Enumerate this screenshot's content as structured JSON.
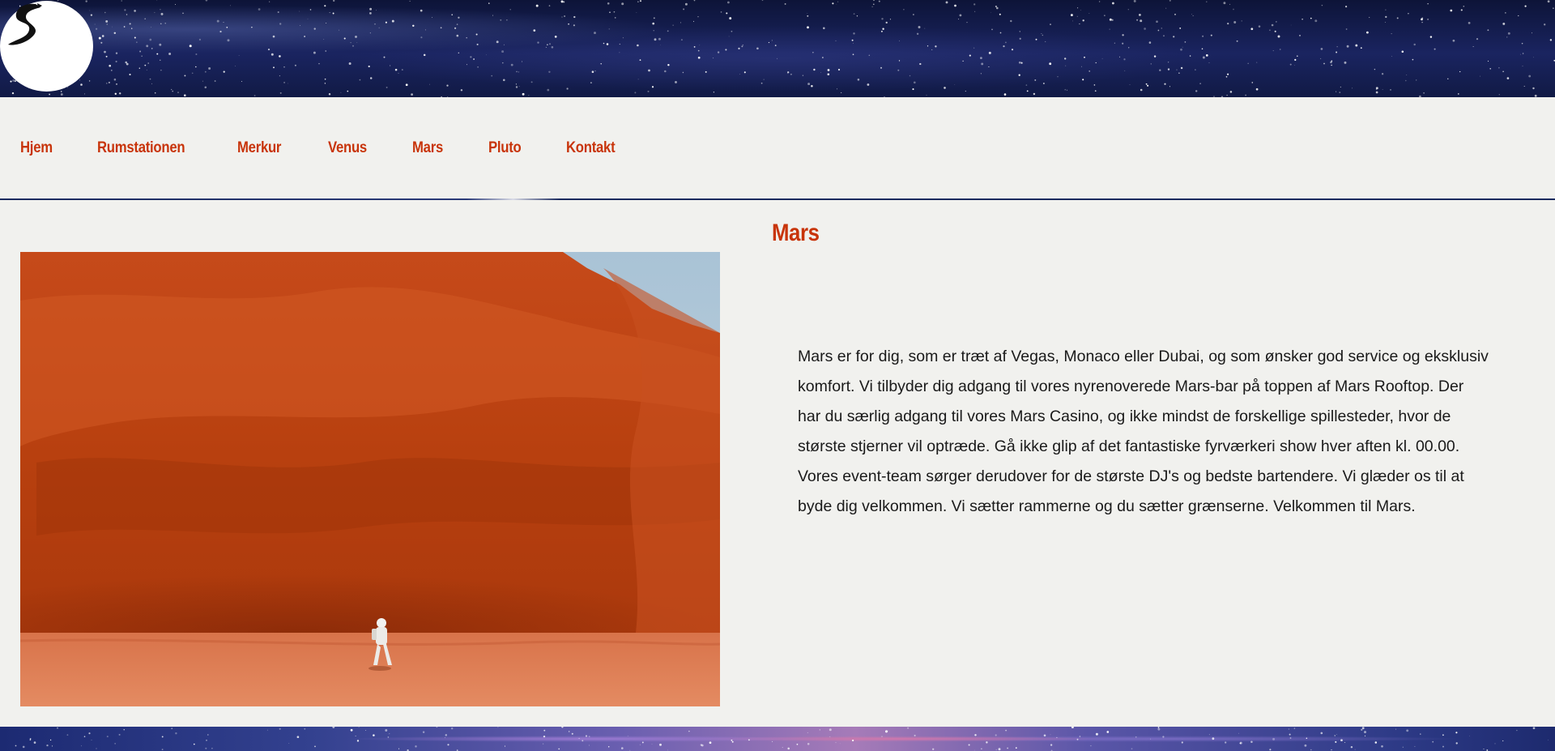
{
  "header": {
    "logo_icon": "stylized-s-logo-icon"
  },
  "nav": {
    "items": [
      {
        "label": "Hjem"
      },
      {
        "label": "Rumstationen"
      },
      {
        "label": "Merkur"
      },
      {
        "label": "Venus"
      },
      {
        "label": "Mars"
      },
      {
        "label": "Pluto"
      },
      {
        "label": "Kontakt"
      }
    ]
  },
  "main": {
    "title": "Mars",
    "paragraph": "Mars er for dig, som er træt af Vegas, Monaco eller Dubai, og som ønsker god service og eksklusiv komfort. Vi tilbyder dig adgang til vores nyrenoverede Mars-bar på toppen af Mars Rooftop. Der har du særlig adgang til vores Mars Casino, og ikke mindst de forskellige spillesteder, hvor de største stjerner vil optræde. Gå ikke glip af det fantastiske fyrværkeri show hver aften kl. 00.00. Vores event-team sørger derudover for de største DJ's og bedste bartendere. Vi glæder os til at byde dig velkommen. Vi sætter rammerne og du sætter grænserne. Velkommen til Mars."
  },
  "colors": {
    "accent": "#c8340a",
    "background": "#f1f1ee",
    "header_sky": "#131c4e",
    "text": "#1a1a1a"
  }
}
